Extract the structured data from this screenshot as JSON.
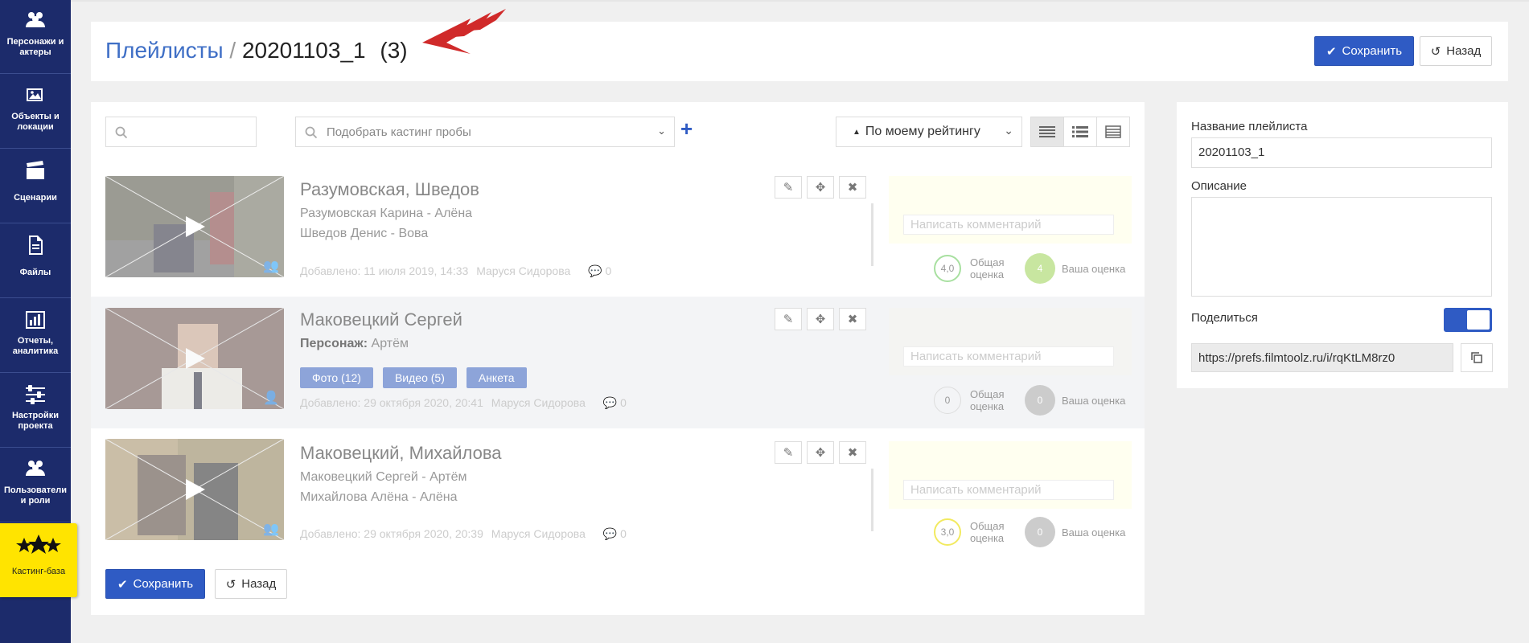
{
  "sidebar": {
    "items": [
      {
        "label": "Персонажи и актеры",
        "icon": "users-icon"
      },
      {
        "label": "Объекты и локации",
        "icon": "image-icon"
      },
      {
        "label": "Сценарии",
        "icon": "clapperboard-icon"
      },
      {
        "label": "Файлы",
        "icon": "file-icon"
      },
      {
        "label": "Отчеты, аналитика",
        "icon": "chart-icon"
      },
      {
        "label": "Настройки проекта",
        "icon": "sliders-icon"
      },
      {
        "label": "Пользователи и роли",
        "icon": "users-icon"
      },
      {
        "label": "Кастинг-база",
        "icon": "stars-icon"
      }
    ]
  },
  "header": {
    "breadcrumb_link": "Плейлисты",
    "breadcrumb_sep": "/",
    "title": "20201103_1",
    "count": "(3)",
    "save_label": "Сохранить",
    "back_label": "Назад"
  },
  "toolbar": {
    "search_value": "",
    "cast_placeholder": "Подобрать кастинг пробы",
    "add_symbol": "+",
    "sort_label": "По моему рейтингу"
  },
  "rows": [
    {
      "title": "Разумовская, Шведов",
      "lines": [
        "Разумовская Карина - Алёна",
        "Шведов Денис - Вова"
      ],
      "added": "Добавлено: 11 июля 2019, 14:33",
      "author": "Маруся Сидорова",
      "comments": "0",
      "comment_placeholder": "Написать комментарий",
      "overall": "4,0",
      "overall_label": "Общая оценка",
      "mine": "4",
      "mine_label": "Ваша оценка"
    },
    {
      "title": "Маковецкий Сергей",
      "character_label": "Персонаж:",
      "character": "Артём",
      "tags": [
        "Фото (12)",
        "Видео (5)",
        "Анкета"
      ],
      "added": "Добавлено: 29 октября 2020, 20:41",
      "author": "Маруся Сидорова",
      "comments": "0",
      "comment_placeholder": "Написать комментарий",
      "overall": "0",
      "overall_label": "Общая оценка",
      "mine": "0",
      "mine_label": "Ваша оценка"
    },
    {
      "title": "Маковецкий, Михайлова",
      "lines": [
        "Маковецкий Сергей - Артём",
        "Михайлова Алёна - Алёна"
      ],
      "added": "Добавлено: 29 октября 2020, 20:39",
      "author": "Маруся Сидорова",
      "comments": "0",
      "comment_placeholder": "Написать комментарий",
      "overall": "3,0",
      "overall_label": "Общая оценка",
      "mine": "0",
      "mine_label": "Ваша оценка"
    }
  ],
  "footer": {
    "save_label": "Сохранить",
    "back_label": "Назад"
  },
  "side": {
    "name_label": "Название плейлиста",
    "name_value": "20201103_1",
    "desc_label": "Описание",
    "desc_value": "",
    "share_label": "Поделиться",
    "share_on": true,
    "share_link": "https://prefs.filmtoolz.ru/i/rqKtLM8rz0"
  },
  "colors": {
    "primary": "#2f5bc4",
    "sidebar": "#1c2b6b",
    "active": "#ffe400",
    "arrow": "#d02a2a"
  }
}
